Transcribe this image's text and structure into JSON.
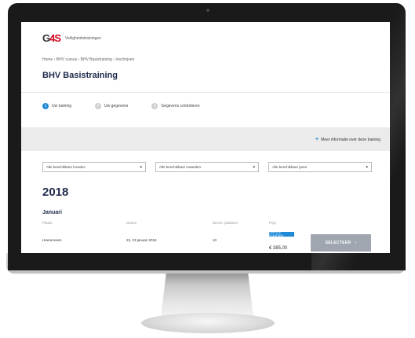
{
  "header": {
    "logo_mark_g": "G",
    "logo_mark_rest": "4S",
    "logo_text": "Veiligheidstrainingen",
    "breadcrumb": "Home  ›  BHV cursus  ›  BHV Basistraining  ›  Inschrijven",
    "page_title": "BHV Basistraining"
  },
  "steps": [
    {
      "num": "1",
      "label": "Uw training"
    },
    {
      "num": "2",
      "label": "Uw gegevens"
    },
    {
      "num": "3",
      "label": "Gegevens controleren"
    }
  ],
  "more_info": {
    "icon": "plus-icon",
    "label": "Meer informatie over deze training"
  },
  "filters": [
    {
      "value": "Alle beschikbare locaties"
    },
    {
      "value": "Alle beschikbare maanden"
    },
    {
      "value": "Alle beschikbare jaren"
    }
  ],
  "schedule": {
    "year": "2018",
    "month": "Januari",
    "columns": [
      "Plaats",
      "Datum",
      "Besch. plaatsen",
      "Prijs"
    ],
    "rows": [
      {
        "place": "Heerenveen",
        "date": "22, 23 januari 2018",
        "seats": "10",
        "badge": "LAATSTE PLAATSEN",
        "price": "€ 385,00",
        "button": "SELECTEER"
      }
    ]
  },
  "colors": {
    "accent": "#1f8ad6",
    "title": "#1e2a4a",
    "button": "#9fa6b0"
  }
}
